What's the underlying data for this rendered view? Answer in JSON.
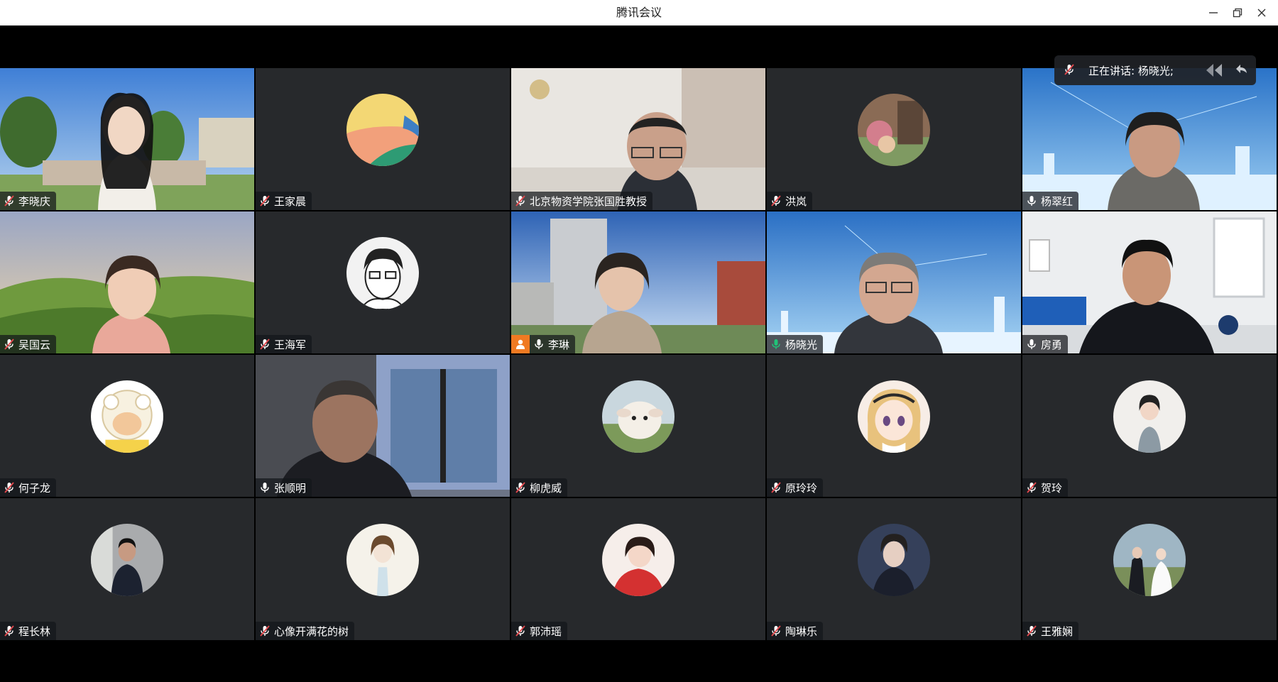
{
  "window": {
    "title": "腾讯会议",
    "controls": [
      "minimize-icon",
      "restore-icon",
      "close-icon"
    ]
  },
  "speaking": {
    "label": "正在讲话: 杨晓光;",
    "icon": "mic-muted-icon"
  },
  "colors": {
    "tile_bg": "#27292c",
    "active_border": "#21c278",
    "host_badge": "#f07a22",
    "mic_on": "#ffffff",
    "mic_active": "#21c278",
    "mic_muted_slash": "#e5484d"
  },
  "participants": [
    {
      "name": "李晓庆",
      "mic": "muted",
      "kind": "video"
    },
    {
      "name": "王家晨",
      "mic": "muted",
      "kind": "avatar"
    },
    {
      "name": "北京物资学院张国胜教授",
      "mic": "muted",
      "kind": "video"
    },
    {
      "name": "洪岚",
      "mic": "muted",
      "kind": "avatar"
    },
    {
      "name": "杨翠红",
      "mic": "on",
      "kind": "video"
    },
    {
      "name": "吴国云",
      "mic": "muted",
      "kind": "video"
    },
    {
      "name": "王海军",
      "mic": "muted",
      "kind": "avatar"
    },
    {
      "name": "李琳",
      "mic": "on",
      "kind": "video",
      "host": true
    },
    {
      "name": "杨晓光",
      "mic": "speaking",
      "kind": "video",
      "active": true
    },
    {
      "name": "房勇",
      "mic": "on",
      "kind": "video"
    },
    {
      "name": "何子龙",
      "mic": "muted",
      "kind": "avatar"
    },
    {
      "name": "张顺明",
      "mic": "on",
      "kind": "video"
    },
    {
      "name": "柳虎威",
      "mic": "muted",
      "kind": "avatar"
    },
    {
      "name": "原玲玲",
      "mic": "muted",
      "kind": "avatar"
    },
    {
      "name": "贺玲",
      "mic": "muted",
      "kind": "avatar"
    },
    {
      "name": "程长林",
      "mic": "muted",
      "kind": "avatar"
    },
    {
      "name": "心像开满花的树",
      "mic": "muted",
      "kind": "avatar"
    },
    {
      "name": "郭沛瑶",
      "mic": "muted",
      "kind": "avatar"
    },
    {
      "name": "陶琳乐",
      "mic": "muted",
      "kind": "avatar"
    },
    {
      "name": "王雅娴",
      "mic": "muted",
      "kind": "avatar"
    }
  ]
}
